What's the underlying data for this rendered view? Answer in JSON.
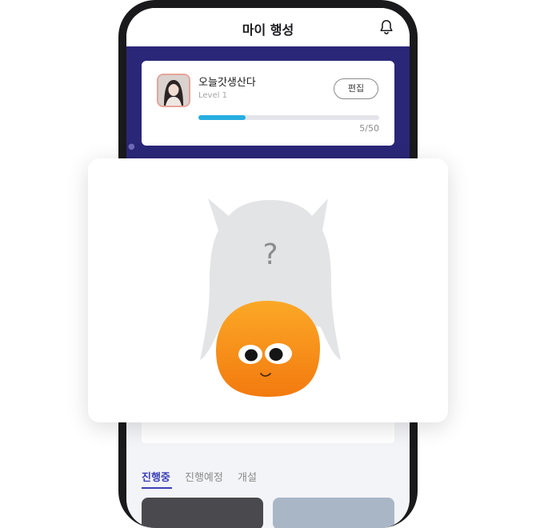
{
  "header": {
    "title": "마이 행성"
  },
  "profile": {
    "name": "오늘갓생산다",
    "level": "Level 1",
    "edit_label": "편집",
    "progress_current": 5,
    "progress_max": 50,
    "progress_text": "5/50"
  },
  "modal": {
    "placeholder_mark": "?"
  },
  "tabs": [
    {
      "label": "진행중",
      "active": true
    },
    {
      "label": "진행예정",
      "active": false
    },
    {
      "label": "개설",
      "active": false
    }
  ],
  "colors": {
    "accent": "#3a3fb6",
    "progress": "#27aee0",
    "space_bg": "#2a2778",
    "character_orange": "#f7941d"
  }
}
